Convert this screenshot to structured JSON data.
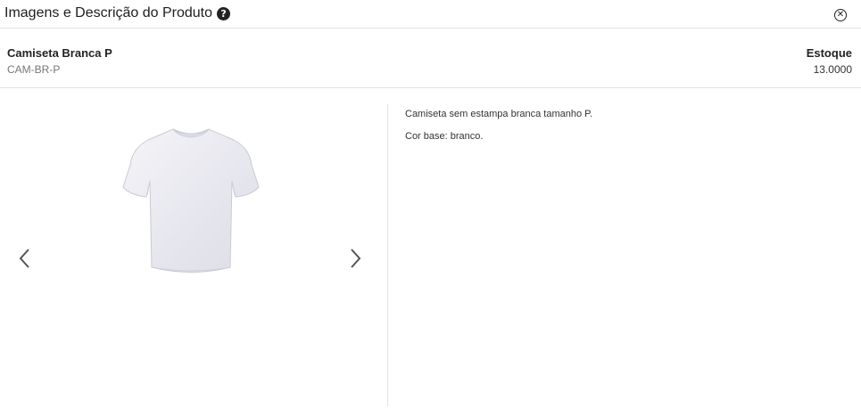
{
  "modal": {
    "title": "Imagens e Descrição do Produto",
    "help_icon": "question-circle-icon",
    "close_icon": "close-circle-icon"
  },
  "product": {
    "name": "Camiseta Branca P",
    "sku": "CAM-BR-P",
    "stock_label": "Estoque",
    "stock_value": "13.0000"
  },
  "gallery": {
    "image_alt": "white-tshirt-image",
    "prev_icon": "chevron-left-icon",
    "next_icon": "chevron-right-icon"
  },
  "description": {
    "paragraphs": [
      "Camiseta sem estampa branca tamanho P.",
      "Cor base: branco."
    ]
  }
}
